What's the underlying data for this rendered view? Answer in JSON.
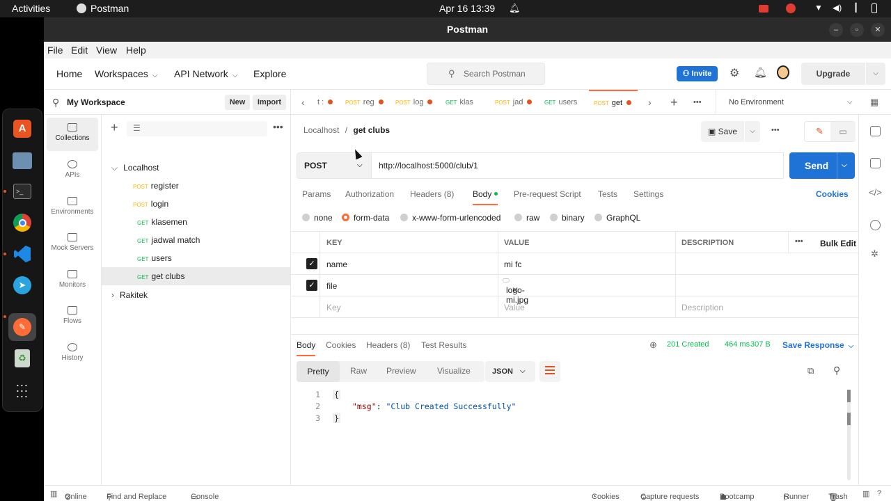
{
  "desktop": {
    "activities": "Activities",
    "app_name": "Postman",
    "datetime": "Apr 16  13:39",
    "accent": "#e95420"
  },
  "dock_icons": [
    "ubuntu-software-icon",
    "files-icon",
    "terminal-icon",
    "chrome-icon",
    "vscode-icon",
    "telegram-icon",
    "postman-icon",
    "trash-icon",
    "app-grid-icon"
  ],
  "window": {
    "title": "Postman",
    "menu": [
      "File",
      "Edit",
      "View",
      "Help"
    ]
  },
  "header": {
    "nav": [
      "Home",
      "Workspaces",
      "API Network",
      "Explore"
    ],
    "search_placeholder": "Search Postman",
    "invite": "Invite",
    "upgrade": "Upgrade",
    "brand_color": "#ff6c37",
    "primary_color": "#1f73d7"
  },
  "workspace": {
    "name": "My Workspace",
    "new_btn": "New",
    "import_btn": "Import"
  },
  "rail": [
    "Collections",
    "APIs",
    "Environments",
    "Mock Servers",
    "Monitors",
    "Flows",
    "History"
  ],
  "tree": {
    "collection": "Localhost",
    "items": [
      {
        "method": "POST",
        "name": "register"
      },
      {
        "method": "POST",
        "name": "login"
      },
      {
        "method": "GET",
        "name": "klasemen"
      },
      {
        "method": "GET",
        "name": "jadwal match"
      },
      {
        "method": "GET",
        "name": "users"
      },
      {
        "method": "GET",
        "name": "get clubs"
      }
    ],
    "collection2": "Rakitek"
  },
  "tabs": [
    {
      "method": "",
      "name": "t :"
    },
    {
      "method": "POST",
      "name": "reg"
    },
    {
      "method": "POST",
      "name": "log"
    },
    {
      "method": "GET",
      "name": "klas"
    },
    {
      "method": "POST",
      "name": "jad"
    },
    {
      "method": "GET",
      "name": "users"
    },
    {
      "method": "POST",
      "name": "get"
    }
  ],
  "environment": "No Environment",
  "request": {
    "crumb_parent": "Localhost",
    "crumb_sep": "/",
    "crumb_name": "get clubs",
    "save": "Save",
    "method": "POST",
    "url": "http://localhost:5000/club/1",
    "send": "Send",
    "tabs": [
      "Params",
      "Authorization",
      "Headers (8)",
      "Body",
      "Pre-request Script",
      "Tests",
      "Settings"
    ],
    "cookies": "Cookies",
    "body_types": [
      "none",
      "form-data",
      "x-www-form-urlencoded",
      "raw",
      "binary",
      "GraphQL"
    ],
    "table_headers": [
      "KEY",
      "VALUE",
      "DESCRIPTION",
      "Bulk Edit"
    ],
    "rows": [
      {
        "key": "name",
        "value": "mi fc"
      },
      {
        "key": "file",
        "value": "logo-mi.jpg"
      }
    ],
    "placeholder_key": "Key",
    "placeholder_value": "Value",
    "placeholder_desc": "Description"
  },
  "response": {
    "tabs": [
      "Body",
      "Cookies",
      "Headers (8)",
      "Test Results"
    ],
    "status": "201 Created",
    "time": "464 ms",
    "size": "307 B",
    "save_response": "Save Response",
    "formats": [
      "Pretty",
      "Raw",
      "Preview",
      "Visualize"
    ],
    "lang": "JSON",
    "lines": [
      {
        "n": "1",
        "text": "{"
      },
      {
        "n": "2",
        "key": "\"msg\"",
        "colon": ": ",
        "value": "\"Club Created Successfully\""
      },
      {
        "n": "3",
        "text": "}"
      }
    ],
    "status_color": "#0cbb52"
  },
  "statusbar": {
    "left": [
      "Online",
      "Find and Replace",
      "Console"
    ],
    "right": [
      "Cookies",
      "Capture requests",
      "Bootcamp",
      "Runner",
      "Trash"
    ]
  }
}
